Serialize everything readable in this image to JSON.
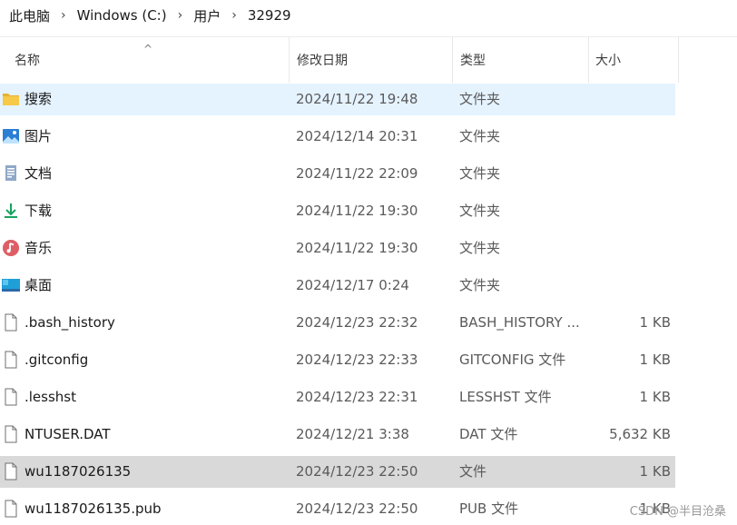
{
  "breadcrumb": [
    "此电脑",
    "Windows (C:)",
    "用户",
    "32929"
  ],
  "breadcrumb_separator": "›",
  "columns": {
    "name": "名称",
    "date": "修改日期",
    "type": "类型",
    "size": "大小"
  },
  "sort_indicator": "^",
  "rows": [
    {
      "name": "搜索",
      "date": "2024/11/22 19:48",
      "type": "文件夹",
      "size": "",
      "icon": "search-folder-icon"
    },
    {
      "name": "图片",
      "date": "2024/12/14 20:31",
      "type": "文件夹",
      "size": "",
      "icon": "pictures-folder-icon"
    },
    {
      "name": "文档",
      "date": "2024/11/22 22:09",
      "type": "文件夹",
      "size": "",
      "icon": "documents-folder-icon"
    },
    {
      "name": "下载",
      "date": "2024/11/22 19:30",
      "type": "文件夹",
      "size": "",
      "icon": "downloads-folder-icon"
    },
    {
      "name": "音乐",
      "date": "2024/11/22 19:30",
      "type": "文件夹",
      "size": "",
      "icon": "music-folder-icon"
    },
    {
      "name": "桌面",
      "date": "2024/12/17 0:24",
      "type": "文件夹",
      "size": "",
      "icon": "desktop-folder-icon"
    },
    {
      "name": ".bash_history",
      "date": "2024/12/23 22:32",
      "type": "BASH_HISTORY ...",
      "size": "1 KB",
      "icon": "file-icon"
    },
    {
      "name": ".gitconfig",
      "date": "2024/12/23 22:33",
      "type": "GITCONFIG 文件",
      "size": "1 KB",
      "icon": "file-icon"
    },
    {
      "name": ".lesshst",
      "date": "2024/12/23 22:31",
      "type": "LESSHST 文件",
      "size": "1 KB",
      "icon": "file-icon"
    },
    {
      "name": "NTUSER.DAT",
      "date": "2024/12/21 3:38",
      "type": "DAT 文件",
      "size": "5,632 KB",
      "icon": "file-icon"
    },
    {
      "name": "wu1187026135",
      "date": "2024/12/23 22:50",
      "type": "文件",
      "size": "1 KB",
      "icon": "file-icon"
    },
    {
      "name": "wu1187026135.pub",
      "date": "2024/12/23 22:50",
      "type": "PUB 文件",
      "size": "1 KB",
      "icon": "file-icon"
    }
  ],
  "watermark": "CSDN @半目沧桑",
  "colors": {
    "hover_row": "#e5f3ff",
    "selected_row": "#d9d9d9",
    "folder_yellow": "#f7c948",
    "accent_blue": "#1e88e5"
  }
}
